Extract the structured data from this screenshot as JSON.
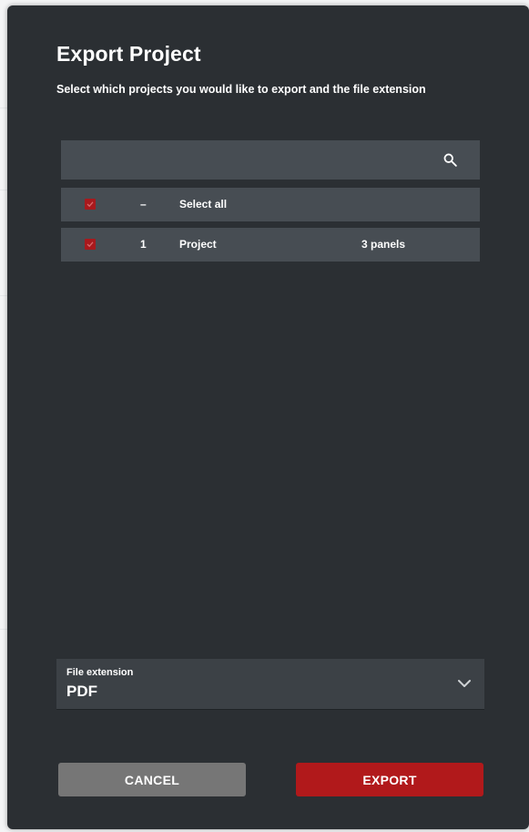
{
  "dialog": {
    "title": "Export Project",
    "subtitle": "Select which projects you would like to export and the file extension"
  },
  "search": {
    "value": "",
    "placeholder": "",
    "icon": "search-icon"
  },
  "table": {
    "select_all": {
      "checked": true,
      "index": "–",
      "label": "Select all"
    },
    "rows": [
      {
        "checked": true,
        "index": "1",
        "name": "Project",
        "panels": "3 panels"
      }
    ]
  },
  "file_extension": {
    "label": "File extension",
    "value": "PDF",
    "icon": "chevron-down-icon"
  },
  "actions": {
    "cancel_label": "CANCEL",
    "export_label": "EXPORT"
  },
  "colors": {
    "dialog_bg": "#2b2f33",
    "row_bg": "#474d53",
    "accent": "#b1191b",
    "cancel_bg": "#767676"
  }
}
